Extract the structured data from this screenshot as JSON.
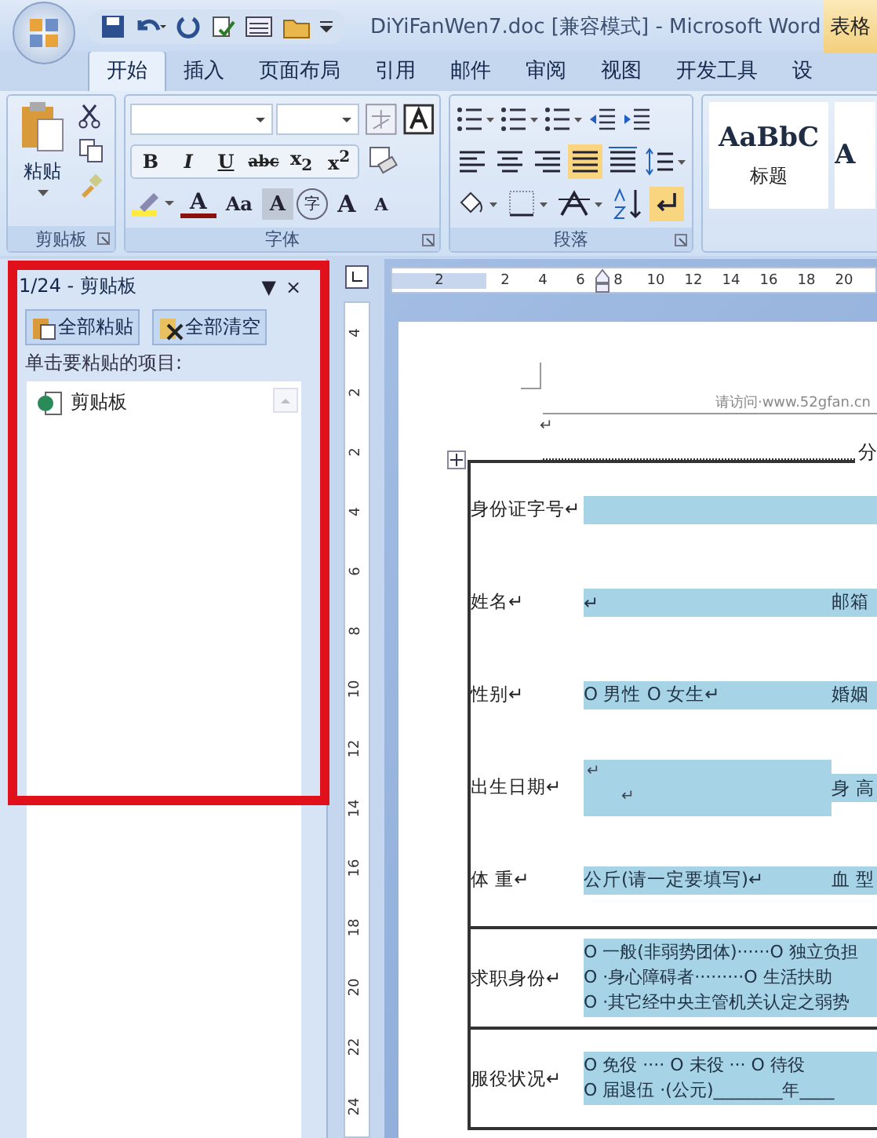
{
  "window": {
    "title": "DiYiFanWen7.doc [兼容模式] - Microsoft Word",
    "context_tab": "表格"
  },
  "tabs": [
    {
      "label": "开始",
      "selected": true
    },
    {
      "label": "插入",
      "selected": false
    },
    {
      "label": "页面布局",
      "selected": false
    },
    {
      "label": "引用",
      "selected": false
    },
    {
      "label": "邮件",
      "selected": false
    },
    {
      "label": "审阅",
      "selected": false
    },
    {
      "label": "视图",
      "selected": false
    },
    {
      "label": "开发工具",
      "selected": false
    },
    {
      "label": "设",
      "selected": false
    }
  ],
  "ribbon": {
    "clipboard": {
      "paste": "粘贴",
      "label": "剪贴板"
    },
    "font": {
      "label": "字体",
      "format_buttons": [
        "B",
        "I",
        "U",
        "abc",
        "x$_{2}$",
        "x$^{2}$"
      ],
      "color_button": "A",
      "case_button": "Aa",
      "shade_button": "A",
      "enclose_button": "字",
      "grow_button": "A",
      "shrink_button": "A"
    },
    "paragraph": {
      "label": "段落"
    },
    "styles": [
      {
        "preview": "AaBbC",
        "name": "标题"
      },
      {
        "preview": "A"
      }
    ]
  },
  "clipboard_pane": {
    "title": "1/24 - 剪贴板",
    "menu_glyph": "▼",
    "close_glyph": "×",
    "buttons": [
      "全部粘贴",
      "全部清空"
    ],
    "hint": "单击要粘贴的项目:",
    "items": [
      {
        "label": "剪贴板"
      }
    ],
    "highlighted": true
  },
  "rulers": {
    "horizontal": [
      "2",
      "2",
      "4",
      "6",
      "8",
      "10",
      "12",
      "14",
      "16",
      "18",
      "20"
    ],
    "vertical": [
      "4",
      "2",
      "2",
      "4",
      "6",
      "8",
      "10",
      "12",
      "14",
      "16",
      "18",
      "20",
      "22",
      "24"
    ]
  },
  "document": {
    "header_text": "请访问·www.52gfan.cn",
    "return_mark": "↵",
    "page_break": "分",
    "rows": [
      {
        "kind": "field",
        "label": "身份证字号↵"
      },
      {
        "kind": "field",
        "label": "姓名↵",
        "value": "↵",
        "right_label": "邮箱"
      },
      {
        "kind": "field",
        "label": "性别↵",
        "value": "O 男性 O 女生↵",
        "right_label": "婚姻"
      },
      {
        "kind": "tall",
        "label": "出生日期↵",
        "lines": [
          "↵",
          "↵"
        ],
        "right_label": "身 高"
      },
      {
        "kind": "field",
        "label": "体 重↵",
        "value": "公斤(请一定要填写)↵",
        "right_label": "血 型"
      },
      {
        "kind": "options",
        "label": "求职身份↵",
        "lines": [
          "O 一般(非弱势团体)······O 独立负担",
          "O ·身心障碍者·········O 生活扶助",
          "O ·其它经中央主管机关认定之弱势"
        ]
      },
      {
        "kind": "options",
        "label": "服役状况↵",
        "lines": [
          "O 免役 ···· O 未役 ··· O 待役",
          "O 届退伍 ·(公元)________年____"
        ]
      }
    ]
  }
}
